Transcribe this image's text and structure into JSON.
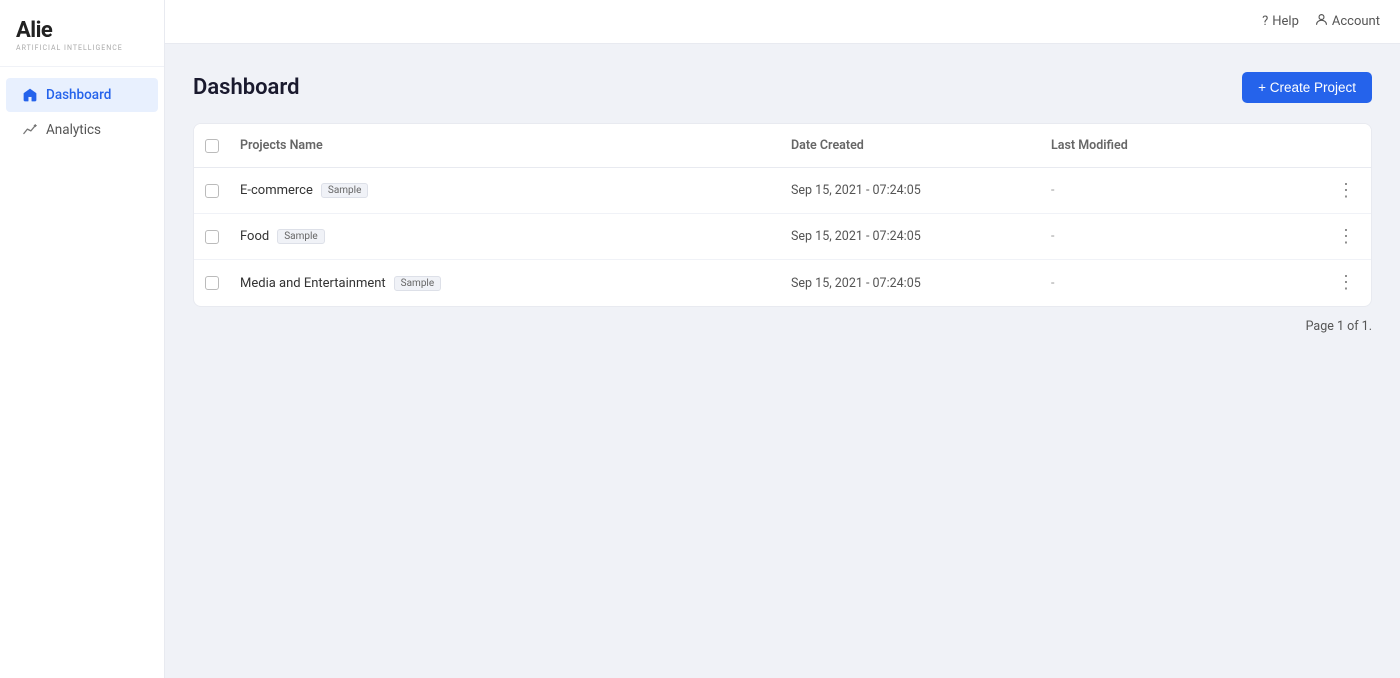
{
  "app": {
    "name": "Alie",
    "tagline": "artificial intelligence"
  },
  "topbar": {
    "help_label": "Help",
    "account_label": "Account"
  },
  "sidebar": {
    "items": [
      {
        "id": "dashboard",
        "label": "Dashboard",
        "active": true
      },
      {
        "id": "analytics",
        "label": "Analytics",
        "active": false
      }
    ]
  },
  "main": {
    "page_title": "Dashboard",
    "create_button_label": "+ Create Project"
  },
  "table": {
    "headers": [
      {
        "id": "checkbox",
        "label": ""
      },
      {
        "id": "project_name",
        "label": "Projects Name"
      },
      {
        "id": "date_created",
        "label": "Date Created"
      },
      {
        "id": "last_modified",
        "label": "Last Modified"
      },
      {
        "id": "actions",
        "label": ""
      }
    ],
    "rows": [
      {
        "id": "row-1",
        "name": "E-commerce",
        "badge": "Sample",
        "date_created": "Sep 15, 2021 - 07:24:05",
        "last_modified": "-"
      },
      {
        "id": "row-2",
        "name": "Food",
        "badge": "Sample",
        "date_created": "Sep 15, 2021 - 07:24:05",
        "last_modified": "-"
      },
      {
        "id": "row-3",
        "name": "Media and Entertainment",
        "badge": "Sample",
        "date_created": "Sep 15, 2021 - 07:24:05",
        "last_modified": "-"
      }
    ]
  },
  "pagination": {
    "label": "Page 1 of 1."
  }
}
